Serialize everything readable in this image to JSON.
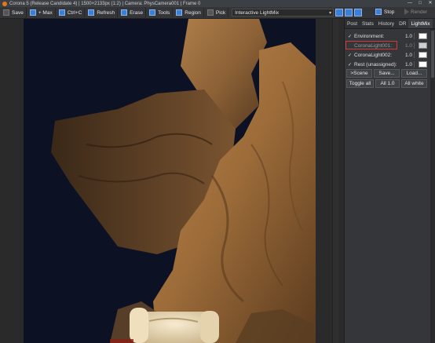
{
  "window": {
    "title": "Corona 5 (Release Candidate 4) | 1500×2133px (1:2) | Camera: PhysCamera001 | Frame 0",
    "controls": [
      "—",
      "□",
      "✕"
    ]
  },
  "toolbar": {
    "save": "Save",
    "max": "+ Max",
    "copy": "Ctrl+C",
    "refresh": "Refresh",
    "erase": "Erase",
    "tools": "Tools",
    "region": "Region",
    "pick": "Pick",
    "view_select": "Interactive LightMix",
    "stop": "Stop",
    "render": "Render"
  },
  "panel": {
    "tabs": [
      "Post",
      "Stats",
      "History",
      "DR",
      "LightMix"
    ],
    "active_tab": "LightMix",
    "lights": [
      {
        "name": "Environment:",
        "value": "1.0",
        "checked": true
      },
      {
        "name": "CoronaLight001:",
        "value": "1.0",
        "checked": false
      },
      {
        "name": "CoronaLight002:",
        "value": "1.0",
        "checked": true
      },
      {
        "name": "Rest (unassigned):",
        "value": "1.0",
        "checked": true
      }
    ],
    "buttons_row1": [
      ">Scene",
      "Save...",
      "Load..."
    ],
    "buttons_row2": [
      "Toggle all",
      "All 1.0",
      "All white"
    ]
  },
  "colors": {
    "accent": "#3d7fd6",
    "highlight": "#d23a3a",
    "rock": "#a9763f",
    "sky": "#0c1224"
  }
}
